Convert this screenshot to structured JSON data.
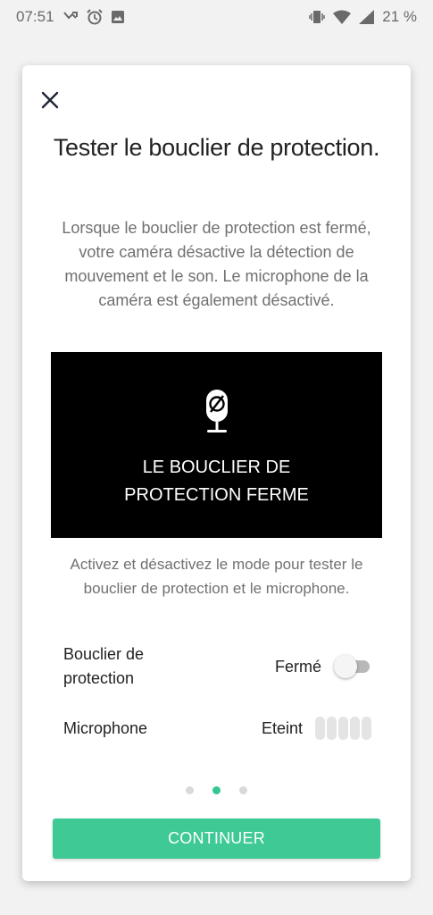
{
  "status_bar": {
    "time": "07:51",
    "left_icons": [
      "missed-call-icon",
      "alarm-icon",
      "image-icon"
    ],
    "right_icons": [
      "vibrate-icon",
      "wifi-icon",
      "signal-icon"
    ],
    "battery": "21 %"
  },
  "dialog": {
    "close_icon": "close-icon",
    "title": "Tester le bouclier de protection.",
    "description": "Lorsque le bouclier de protection est fermé, votre caméra désactive la détection de mouvement et le son. Le microphone de la caméra est également désactivé.",
    "preview": {
      "icon": "mic-off-icon",
      "text": "LE BOUCLIER DE\nPROTECTION FERME"
    },
    "instruction": "Activez et désactivez le mode pour tester le bouclier de protection et le microphone.",
    "rows": [
      {
        "label": "Bouclier de protection",
        "value": "Fermé",
        "control": "toggle",
        "on": false
      },
      {
        "label": "Microphone",
        "value": "Eteint",
        "control": "level-meter",
        "active_bars": 0,
        "total_bars": 5
      }
    ],
    "pagination": {
      "total": 3,
      "current": 2
    },
    "continue_label": "CONTINUER"
  },
  "colors": {
    "accent": "#3ec995",
    "active_dot": "#34c791",
    "preview_bg": "#000000"
  }
}
